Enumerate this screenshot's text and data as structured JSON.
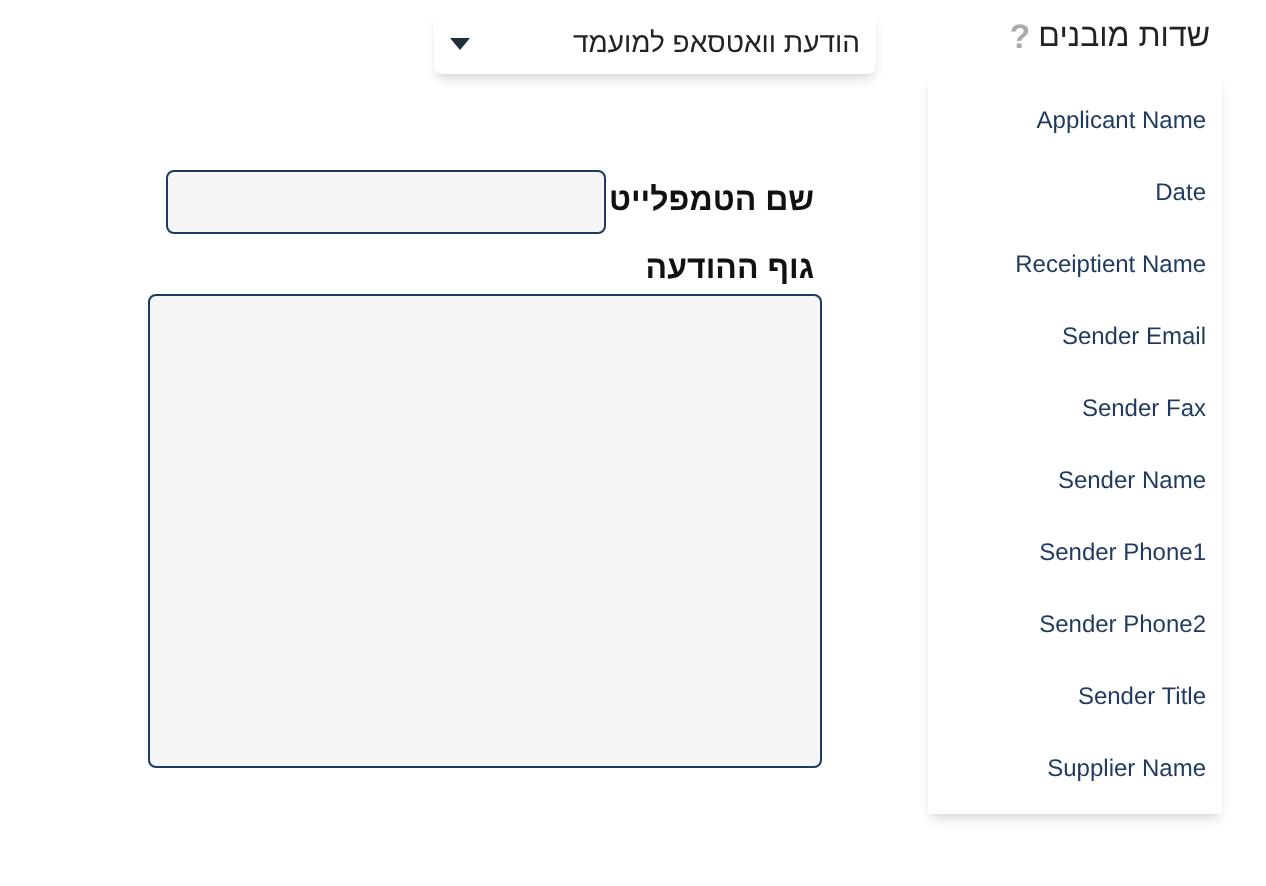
{
  "message_type_dropdown": {
    "value": "הודעת וואטסאפ למועמד"
  },
  "template_name": {
    "label": "שם הטמפלייט"
  },
  "message_body": {
    "label": "גוף ההודעה"
  },
  "builtin_fields": {
    "title": "שדות מובנים",
    "help": "?",
    "items": [
      "Applicant Name",
      "Date",
      "Receiptient Name",
      "Sender Email",
      "Sender Fax",
      "Sender Name",
      "Sender Phone1",
      "Sender Phone2",
      "Sender Title",
      "Supplier Name"
    ]
  }
}
